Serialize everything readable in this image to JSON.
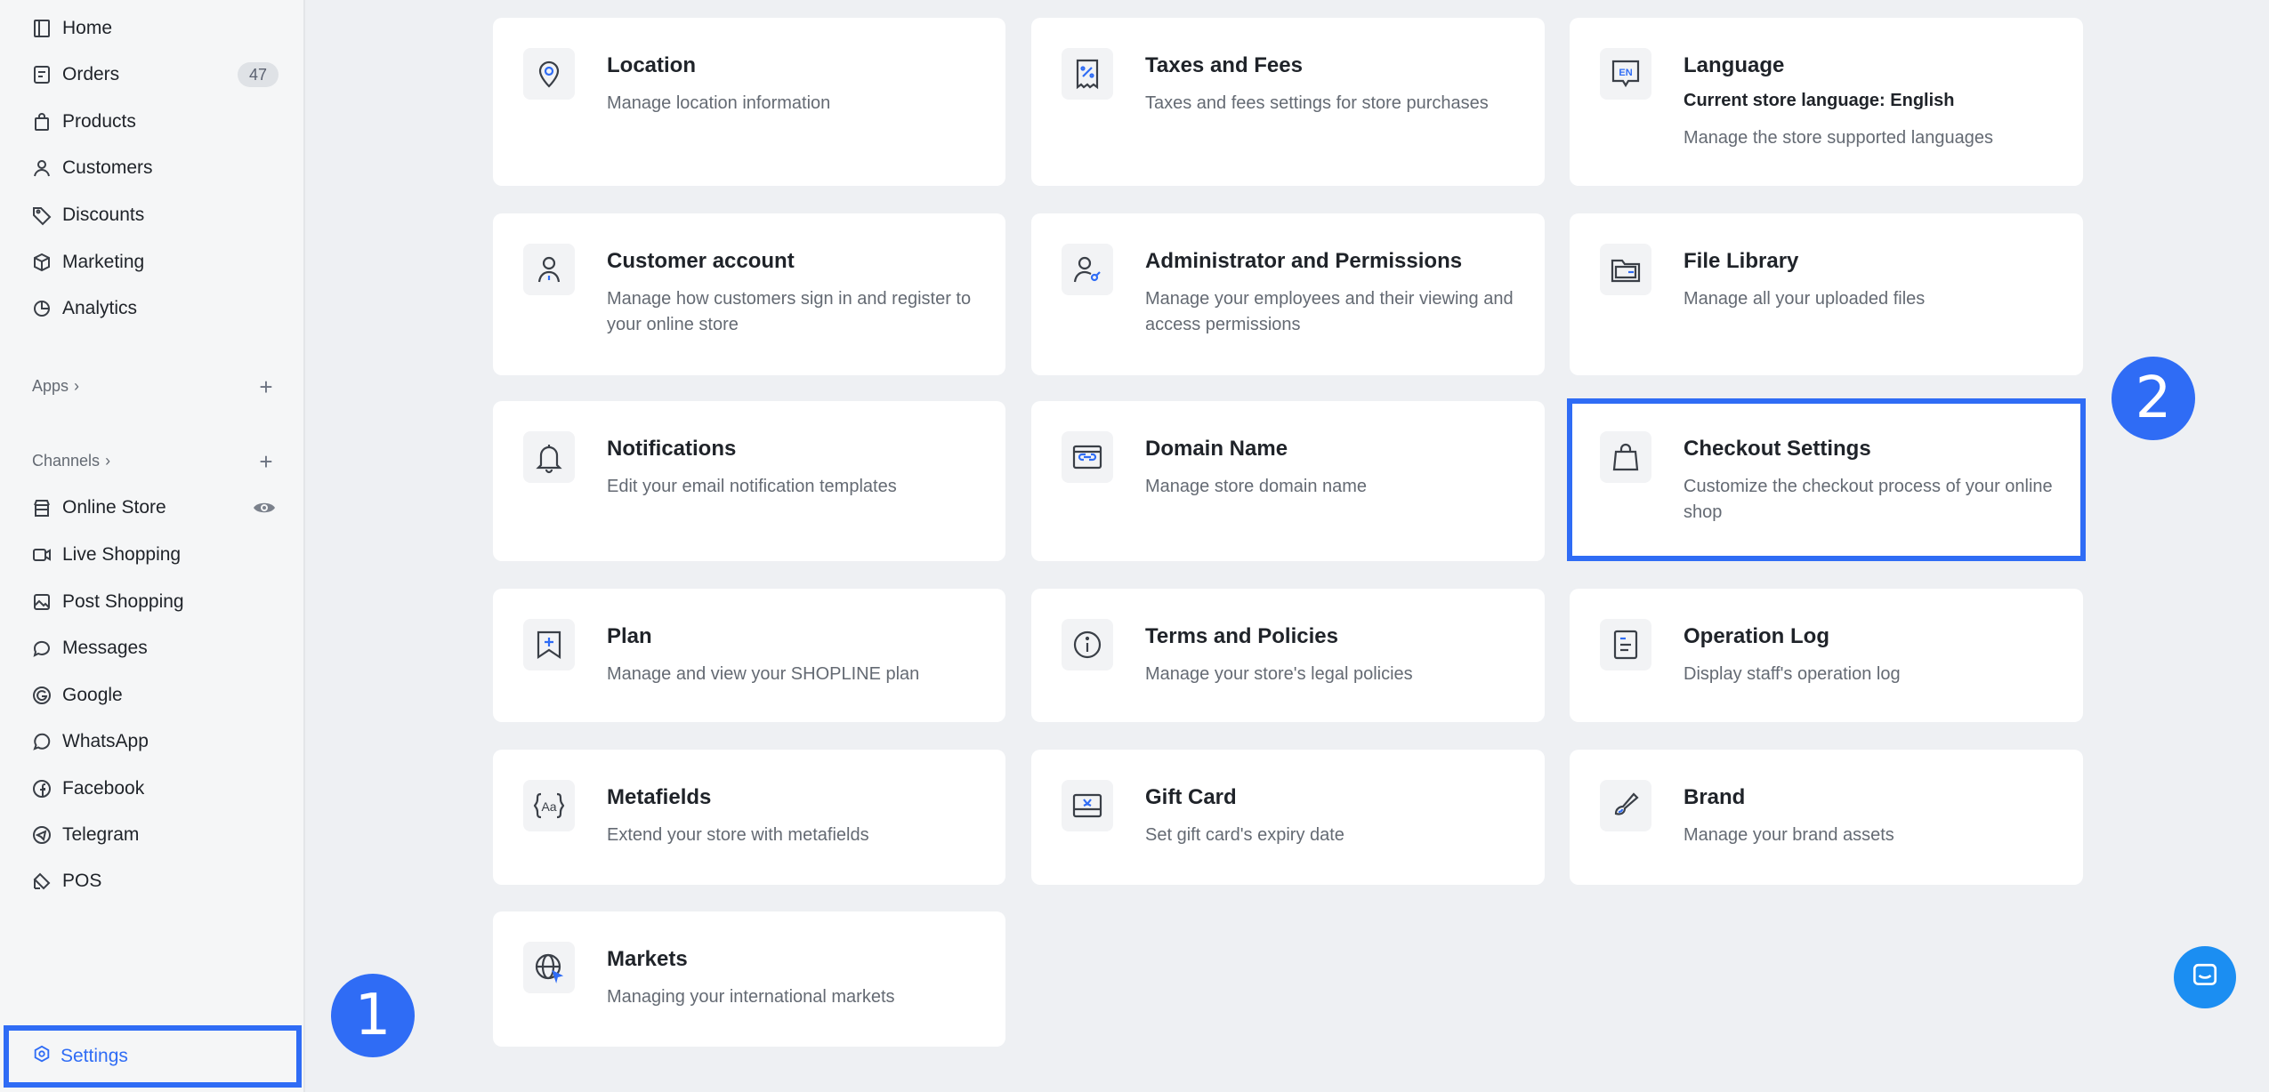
{
  "sidebar": {
    "items": [
      {
        "label": "Home",
        "icon": "home-icon"
      },
      {
        "label": "Orders",
        "icon": "orders-icon",
        "badge": "47"
      },
      {
        "label": "Products",
        "icon": "bag-icon"
      },
      {
        "label": "Customers",
        "icon": "user-icon"
      },
      {
        "label": "Discounts",
        "icon": "tag-icon"
      },
      {
        "label": "Marketing",
        "icon": "cube-icon"
      },
      {
        "label": "Analytics",
        "icon": "pie-icon"
      }
    ],
    "apps_label": "Apps",
    "channels_label": "Channels",
    "channels": [
      {
        "label": "Online Store",
        "icon": "store-icon"
      },
      {
        "label": "Live Shopping",
        "icon": "video-icon"
      },
      {
        "label": "Post Shopping",
        "icon": "image-icon"
      },
      {
        "label": "Messages",
        "icon": "chat-icon"
      },
      {
        "label": "Google",
        "icon": "google-icon"
      },
      {
        "label": "WhatsApp",
        "icon": "whatsapp-icon"
      },
      {
        "label": "Facebook",
        "icon": "facebook-icon"
      },
      {
        "label": "Telegram",
        "icon": "telegram-icon"
      },
      {
        "label": "POS",
        "icon": "pos-icon"
      }
    ],
    "settings_label": "Settings"
  },
  "annotations": {
    "step1": "1",
    "step2": "2"
  },
  "cards": [
    {
      "title": "Location",
      "desc": "Manage location information",
      "icon": "location-pin-icon"
    },
    {
      "title": "Taxes and Fees",
      "desc": "Taxes and fees settings for store purchases",
      "icon": "receipt-percent-icon"
    },
    {
      "title": "Language",
      "sub": "Current store language: English",
      "desc": "Manage the store supported languages",
      "icon": "language-en-icon"
    },
    {
      "title": "Customer account",
      "desc": "Manage how customers sign in and register to your online store",
      "icon": "customer-account-icon"
    },
    {
      "title": "Administrator and Permissions",
      "desc": "Manage your employees and their viewing and access permissions",
      "icon": "admin-key-icon"
    },
    {
      "title": "File Library",
      "desc": "Manage all your uploaded files",
      "icon": "folder-icon"
    },
    {
      "title": "Notifications",
      "desc": "Edit your email notification templates",
      "icon": "bell-icon"
    },
    {
      "title": "Domain Name",
      "desc": "Manage store domain name",
      "icon": "domain-link-icon"
    },
    {
      "title": "Checkout Settings",
      "desc": "Customize the checkout process of your online shop",
      "icon": "shopping-bag-icon"
    },
    {
      "title": "Plan",
      "desc": "Manage and view your SHOPLINE plan",
      "icon": "plan-bookmark-icon"
    },
    {
      "title": "Terms and Policies",
      "desc": "Manage your store's legal policies",
      "icon": "info-icon"
    },
    {
      "title": "Operation Log",
      "desc": "Display staff's operation log",
      "icon": "log-document-icon"
    },
    {
      "title": "Metafields",
      "desc": "Extend your store with metafields",
      "icon": "metafields-icon"
    },
    {
      "title": "Gift Card",
      "desc": "Set gift card's expiry date",
      "icon": "gift-card-icon"
    },
    {
      "title": "Brand",
      "desc": "Manage your brand assets",
      "icon": "brand-brush-icon"
    },
    {
      "title": "Markets",
      "desc": "Managing your international markets",
      "icon": "globe-icon"
    }
  ],
  "colors": {
    "accent": "#2f6cf5",
    "chat": "#1b8ef2"
  }
}
